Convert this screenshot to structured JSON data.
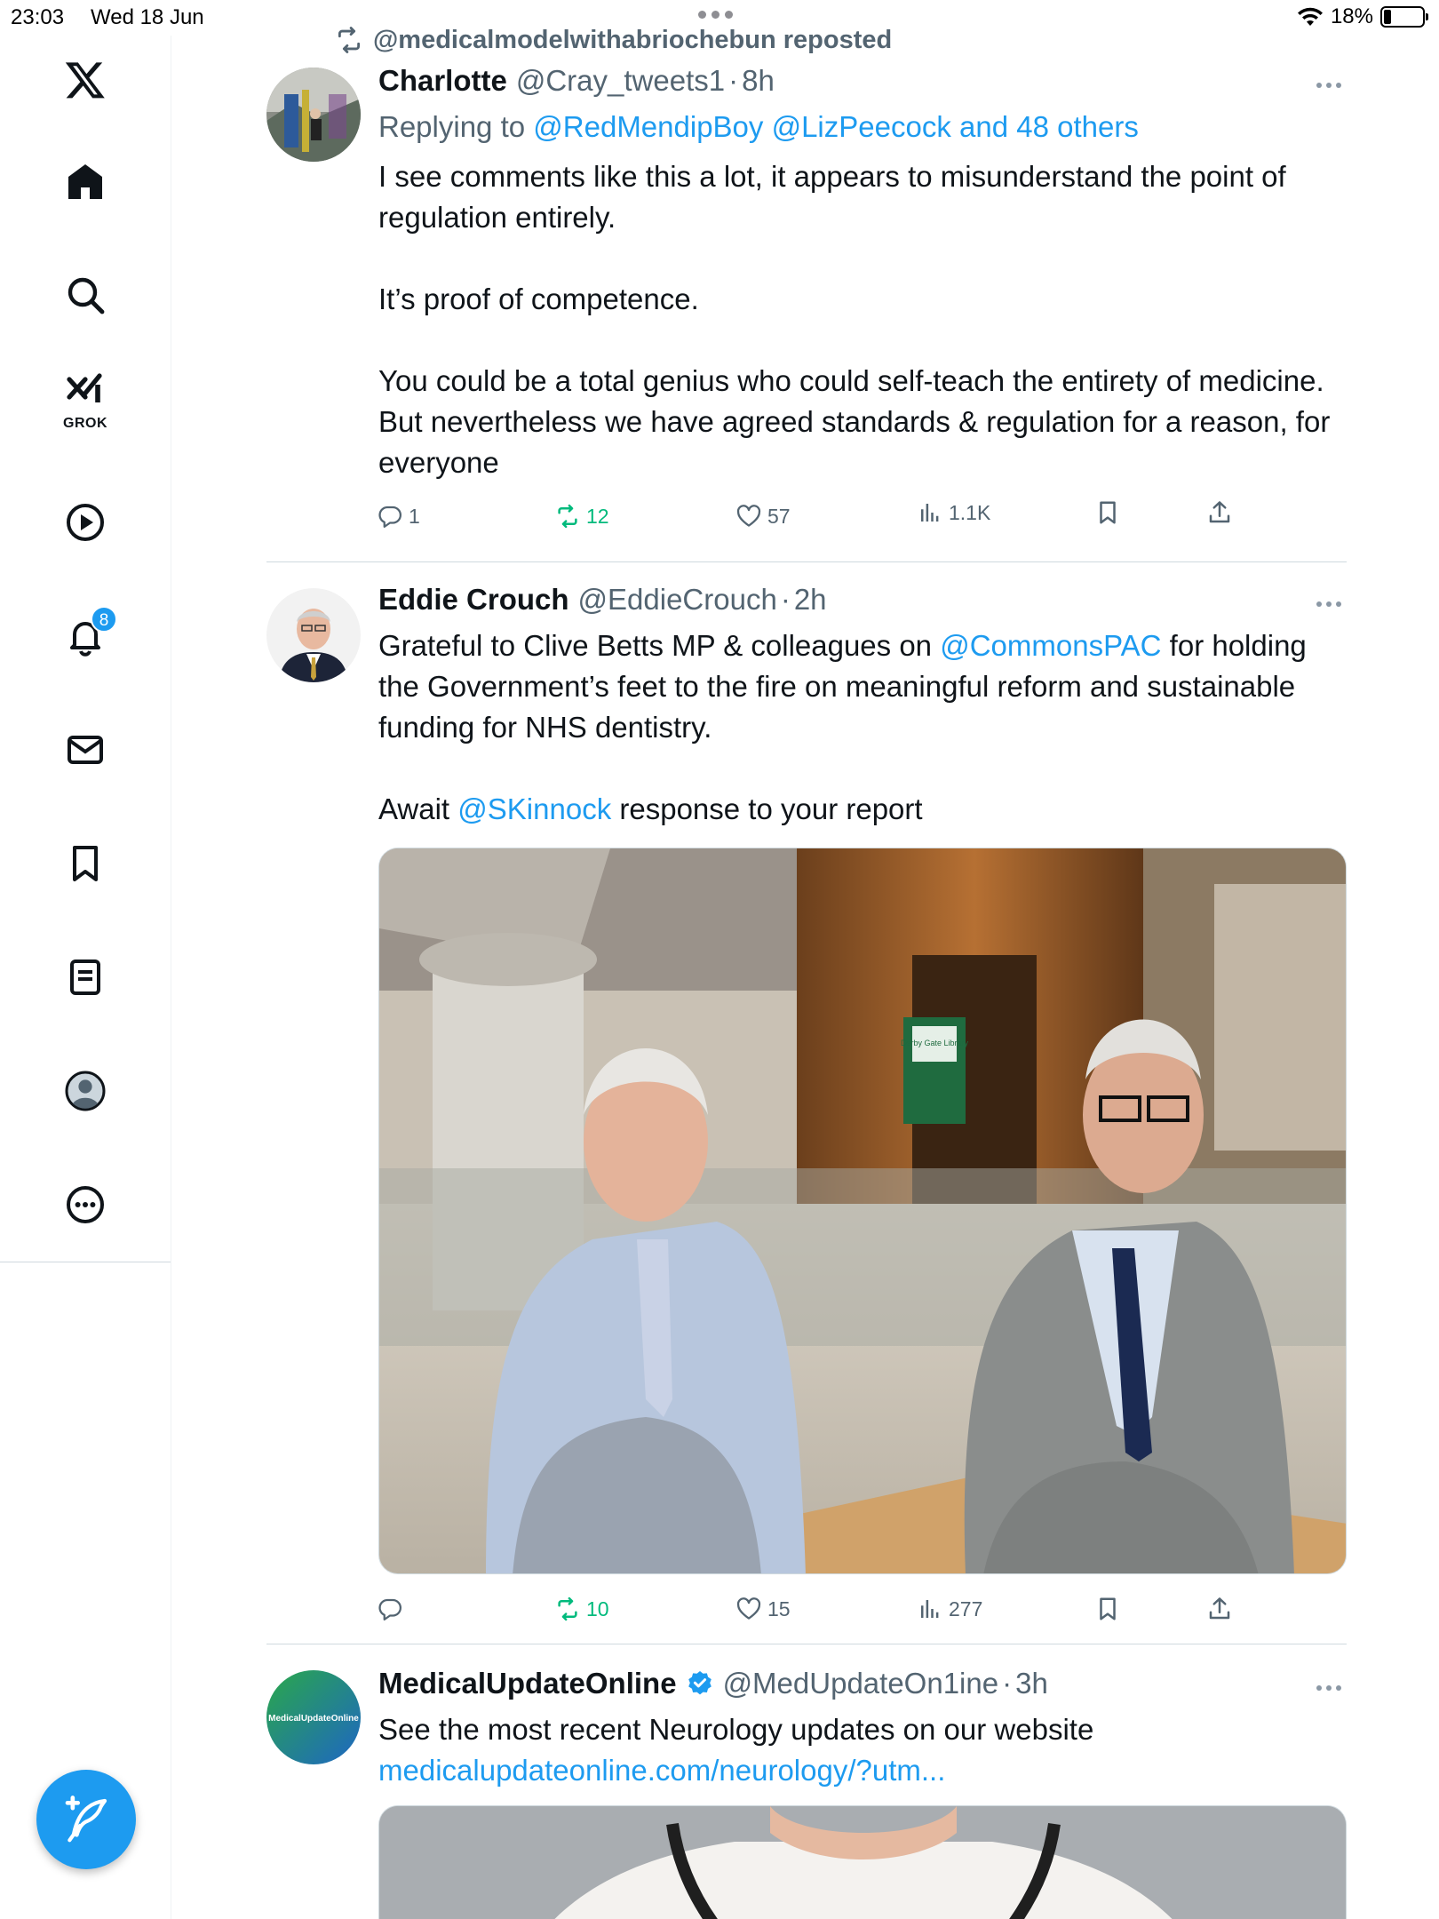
{
  "status_bar": {
    "time": "23:03",
    "date": "Wed 18 Jun",
    "battery_percent": "18%",
    "battery_level": 0.18
  },
  "sidebar": {
    "items": [
      {
        "id": "logo",
        "icon": "x-logo-icon"
      },
      {
        "id": "home",
        "icon": "home-icon"
      },
      {
        "id": "search",
        "icon": "search-icon"
      },
      {
        "id": "grok",
        "icon": "grok-icon",
        "label": "GROK"
      },
      {
        "id": "video",
        "icon": "play-icon"
      },
      {
        "id": "notifications",
        "icon": "bell-icon",
        "badge": "8"
      },
      {
        "id": "messages",
        "icon": "mail-icon"
      },
      {
        "id": "bookmarks",
        "icon": "bookmark-icon"
      },
      {
        "id": "lists",
        "icon": "list-icon"
      },
      {
        "id": "profile",
        "icon": "profile-icon"
      },
      {
        "id": "more",
        "icon": "more-circle-icon"
      }
    ],
    "compose_icon": "compose-icon"
  },
  "feed": {
    "repost_banner": "@medicalmodelwithabriochebun reposted",
    "tweets": [
      {
        "name": "Charlotte",
        "handle": "@Cray_tweets1",
        "dot": "·",
        "time": "8h",
        "replying_prefix": "Replying to",
        "replying_to": "@RedMendipBoy @LizPeecock and 48 others",
        "body": [
          "I see comments like this a lot, it appears to misunderstand the point of regulation entirely.",
          "It’s proof of competence.",
          "You could be a total genius who could self-teach the entirety of medicine. But nevertheless we have agreed standards & regulation for a reason, for everyone"
        ],
        "replies": "1",
        "reposts": "12",
        "likes": "57",
        "views": "1.1K"
      },
      {
        "name": "Eddie Crouch",
        "handle": "@EddieCrouch",
        "dot": "·",
        "time": "2h",
        "body_a_pre": "Grateful to Clive Betts MP & colleagues on ",
        "body_a_link": "@CommonsPAC",
        "body_a_post": " for holding the Government’s feet to the fire on meaningful reform and sustainable funding for NHS dentistry.",
        "body_b_pre": "Await ",
        "body_b_link": "@SKinnock",
        "body_b_post": " response to your report",
        "sign_text": "Derby Gate Library",
        "replies": "",
        "reposts": "10",
        "likes": "15",
        "views": "277"
      },
      {
        "name": "MedicalUpdateOnline",
        "handle": "@MedUpdateOn1ine",
        "dot": "·",
        "time": "3h",
        "verified": true,
        "avatar_text": "MedicalUpdateOnline",
        "body": "See the most recent Neurology updates on our website",
        "link": "medicalupdateonline.com/neurology/?utm..."
      }
    ]
  },
  "colors": {
    "accent": "#1d9bf0",
    "repost_green": "#00ba7c",
    "secondary_text": "#536471"
  }
}
